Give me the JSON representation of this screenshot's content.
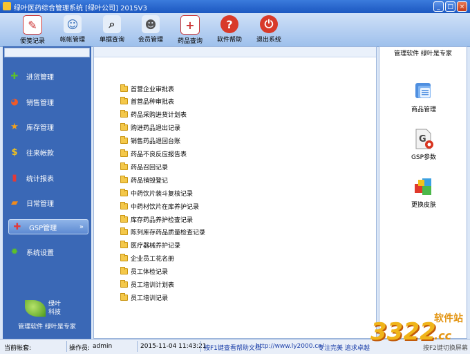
{
  "window": {
    "title": "绿叶医药综合管理系统 [绿叶公司] 2015V3",
    "minimize": "_",
    "maximize": "□",
    "close": "×"
  },
  "toolbar": [
    {
      "label": "便笺记录",
      "icon": "note-icon",
      "color": "#ffffff",
      "glyph": "✎"
    },
    {
      "label": "帐帐管理",
      "icon": "users-icon",
      "color": "#ffffff",
      "glyph": "☺"
    },
    {
      "label": "单据查询",
      "icon": "search-icon",
      "color": "#ffffff",
      "glyph": "⌕"
    },
    {
      "label": "会员管理",
      "icon": "members-icon",
      "color": "#ffffff",
      "glyph": "☻"
    },
    {
      "label": "药品查询",
      "icon": "medicine-icon",
      "color": "#ffffff",
      "glyph": "+"
    },
    {
      "label": "软件帮助",
      "icon": "help-icon",
      "color": "#d83a2a",
      "glyph": "?"
    },
    {
      "label": "退出系统",
      "icon": "power-icon",
      "color": "#d83a2a",
      "glyph": "⏻"
    }
  ],
  "sidebar": {
    "items": [
      {
        "label": "进货管理",
        "icon": "plus-icon",
        "glyph": "✚",
        "color": "#5cc02a"
      },
      {
        "label": "销售管理",
        "icon": "pie-chart-icon",
        "glyph": "◕",
        "color": "#f05a28"
      },
      {
        "label": "库存管理",
        "icon": "star-icon",
        "glyph": "★",
        "color": "#f2a11c"
      },
      {
        "label": "往来帐款",
        "icon": "dollar-icon",
        "glyph": "$",
        "color": "#f2c21c"
      },
      {
        "label": "统计报表",
        "icon": "bar-chart-icon",
        "glyph": "▮",
        "color": "#e03a3a"
      },
      {
        "label": "日常管理",
        "icon": "folder-icon",
        "glyph": "▰",
        "color": "#f08a1c"
      },
      {
        "label": "GSP管理",
        "icon": "gsp-icon",
        "glyph": "✚",
        "color": "#e23a3a",
        "active": true,
        "chevron": "»"
      },
      {
        "label": "系统设置",
        "icon": "gear-icon",
        "glyph": "✹",
        "color": "#5cc02a"
      }
    ],
    "logo_text": "绿叶\n科技",
    "slogan": "管理软件 绿叶是专家"
  },
  "documents": [
    "首营企业审批表",
    "首营品种审批表",
    "药品采购进货计划表",
    "购进药品退出记录",
    "销售药品退回台账",
    "药品不良反应报告表",
    "药品召回记录",
    "药品销毁登记",
    "中药饮片装斗复核记录",
    "中药材饮片在库养护记录",
    "库存药品养护检查记录",
    "陈列库存药品质量检查记录",
    "医疗器械养护记录",
    "企业员工花名册",
    "员工体检记录",
    "员工培训计划表",
    "员工培训记录"
  ],
  "right_panel": {
    "header": "管理软件 绿叶是专家",
    "tools": [
      {
        "label": "商品管理",
        "icon": "product-icon"
      },
      {
        "label": "GSP参数",
        "icon": "gsp-settings-icon"
      },
      {
        "label": "更换皮肤",
        "icon": "skin-icon"
      }
    ]
  },
  "status": {
    "account_label": "当前帐套:",
    "account_value": "",
    "operator_label": "操作员:",
    "operator_value": "admin",
    "datetime": "2015-11-04 11:43:21",
    "help_text": "按F1键查看帮助文档",
    "website": "http://www.ly2000.cn/",
    "slogan": "专注完美 追求卓越",
    "hotkey": "按F2键切换屏幕"
  },
  "watermark": {
    "number": "3322",
    "site": "软件站",
    "domain": ".cc"
  }
}
